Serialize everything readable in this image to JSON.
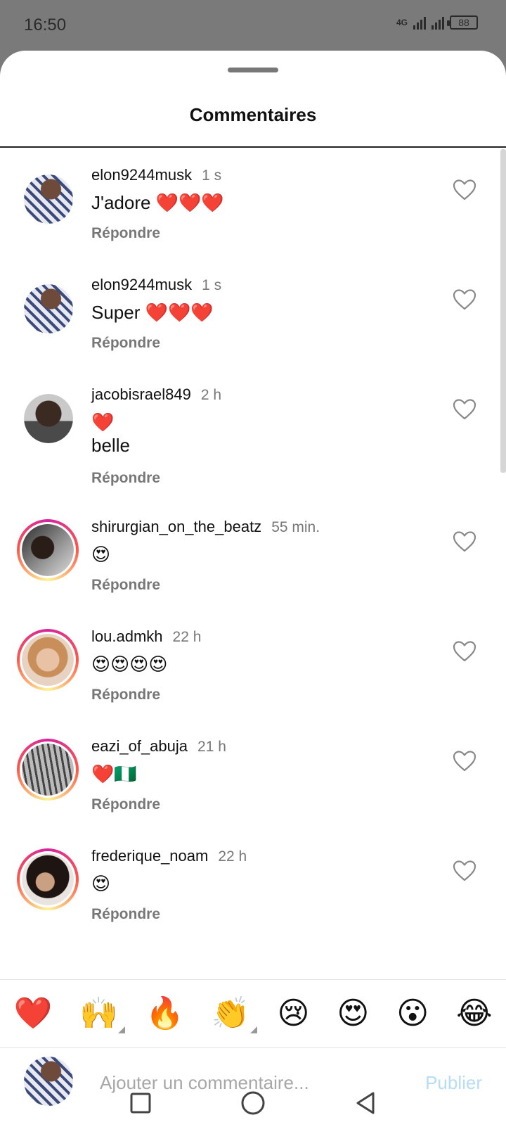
{
  "status_bar": {
    "time": "16:50",
    "network": "4G",
    "battery": "88"
  },
  "sheet": {
    "title": "Commentaires"
  },
  "comments": [
    {
      "username": "elon9244musk",
      "time": "1 s",
      "text": "J'adore ❤️❤️❤️",
      "reply": "Répondre",
      "avatar": "elon",
      "ring": false
    },
    {
      "username": "elon9244musk",
      "time": "1 s",
      "text": "Super ❤️❤️❤️",
      "reply": "Répondre",
      "avatar": "elon",
      "ring": false
    },
    {
      "username": "jacobisrael849",
      "time": "2 h",
      "text": "❤️\nbelle",
      "reply": "Répondre",
      "avatar": "jacob",
      "ring": false
    },
    {
      "username": "shirurgian_on_the_beatz",
      "time": "55 min.",
      "text": "😍",
      "reply": "Répondre",
      "avatar": "shir",
      "ring": true
    },
    {
      "username": "lou.admkh",
      "time": "22 h",
      "text": "😍😍😍😍",
      "reply": "Répondre",
      "avatar": "lou",
      "ring": true
    },
    {
      "username": "eazi_of_abuja",
      "time": "21 h",
      "text": "❤️🇳🇬",
      "reply": "Répondre",
      "avatar": "eazi",
      "ring": true
    },
    {
      "username": "frederique_noam",
      "time": "22 h",
      "text": "😍",
      "reply": "Répondre",
      "avatar": "fred",
      "ring": true
    }
  ],
  "emoji_bar": [
    "❤️",
    "🙌",
    "🔥",
    "👏",
    "😢",
    "😍",
    "😮",
    "😂"
  ],
  "composer": {
    "placeholder": "Ajouter un commentaire...",
    "publish_label": "Publier"
  },
  "colors": {
    "publish_disabled": "#b6dcf6",
    "story_ring_start": "#d6249f",
    "story_ring_end": "#fd5949"
  },
  "icons": {
    "like": "heart-outline-icon",
    "nav": [
      "square-recents-icon",
      "circle-home-icon",
      "triangle-back-icon"
    ]
  }
}
